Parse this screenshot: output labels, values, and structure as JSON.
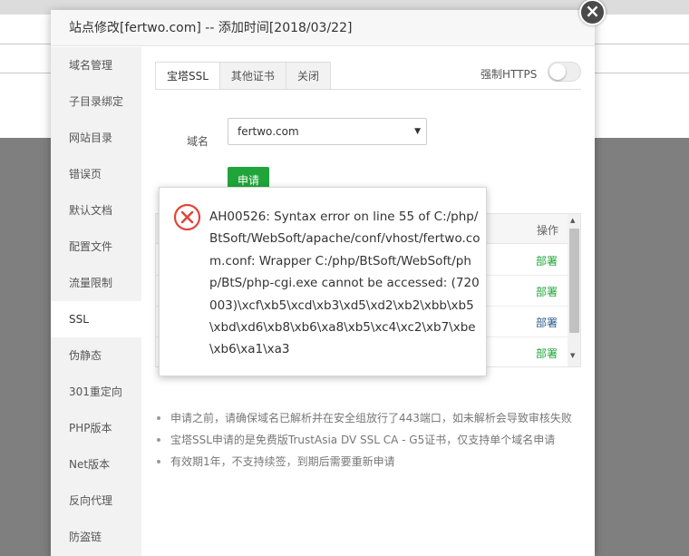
{
  "modal": {
    "title": "站点修改[fertwo.com] -- 添加时间[2018/03/22]",
    "close_label": "×"
  },
  "sidebar": {
    "items": [
      {
        "label": "域名管理"
      },
      {
        "label": "子目录绑定"
      },
      {
        "label": "网站目录"
      },
      {
        "label": "错误页"
      },
      {
        "label": "默认文档"
      },
      {
        "label": "配置文件"
      },
      {
        "label": "流量限制"
      },
      {
        "label": "SSL",
        "active": true
      },
      {
        "label": "伪静态"
      },
      {
        "label": "301重定向"
      },
      {
        "label": "PHP版本"
      },
      {
        "label": "Net版本"
      },
      {
        "label": "反向代理"
      },
      {
        "label": "防盗链"
      }
    ]
  },
  "tabs": [
    {
      "label": "宝塔SSL",
      "active": true
    },
    {
      "label": "其他证书"
    },
    {
      "label": "关闭"
    }
  ],
  "force_https": {
    "label": "强制HTTPS",
    "enabled": false
  },
  "domain": {
    "label": "域名",
    "selected": "fertwo.com"
  },
  "apply_button": "申请",
  "table": {
    "header_op": "操作",
    "rows": [
      {
        "action": "部署",
        "color": "#20a53a"
      },
      {
        "action": "部署",
        "color": "#20a53a"
      },
      {
        "action": "部署",
        "color": "#2b5a8c"
      },
      {
        "action": "部署",
        "color": "#20a53a"
      }
    ]
  },
  "notes": [
    "申请之前，请确保域名已解析并在安全组放行了443端口，如未解析会导致审核失败",
    "宝塔SSL申请的是免费版TrustAsia DV SSL CA - G5证书，仅支持单个域名申请",
    "有效期1年，不支持续签，到期后需要重新申请"
  ],
  "error": {
    "message": "AH00526: Syntax error on line 55 of C:/php/BtSoft/WebSoft/apache/conf/vhost/fertwo.com.conf: Wrapper C:/php/BtSoft/WebSoft/php/BtS/php-cgi.exe cannot be accessed: (720003)\\xcf\\xb5\\xcd\\xb3\\xd5\\xd2\\xb2\\xbb\\xb5\\xbd\\xd6\\xb8\\xb6\\xa8\\xb5\\xc4\\xc2\\xb7\\xbe\\xb6\\xa1\\xa3",
    "icon": "error-circle-x-icon",
    "color": "#e0463b"
  },
  "colors": {
    "accent": "#20a53a",
    "error": "#e0463b",
    "link_blue": "#2b5a8c"
  }
}
